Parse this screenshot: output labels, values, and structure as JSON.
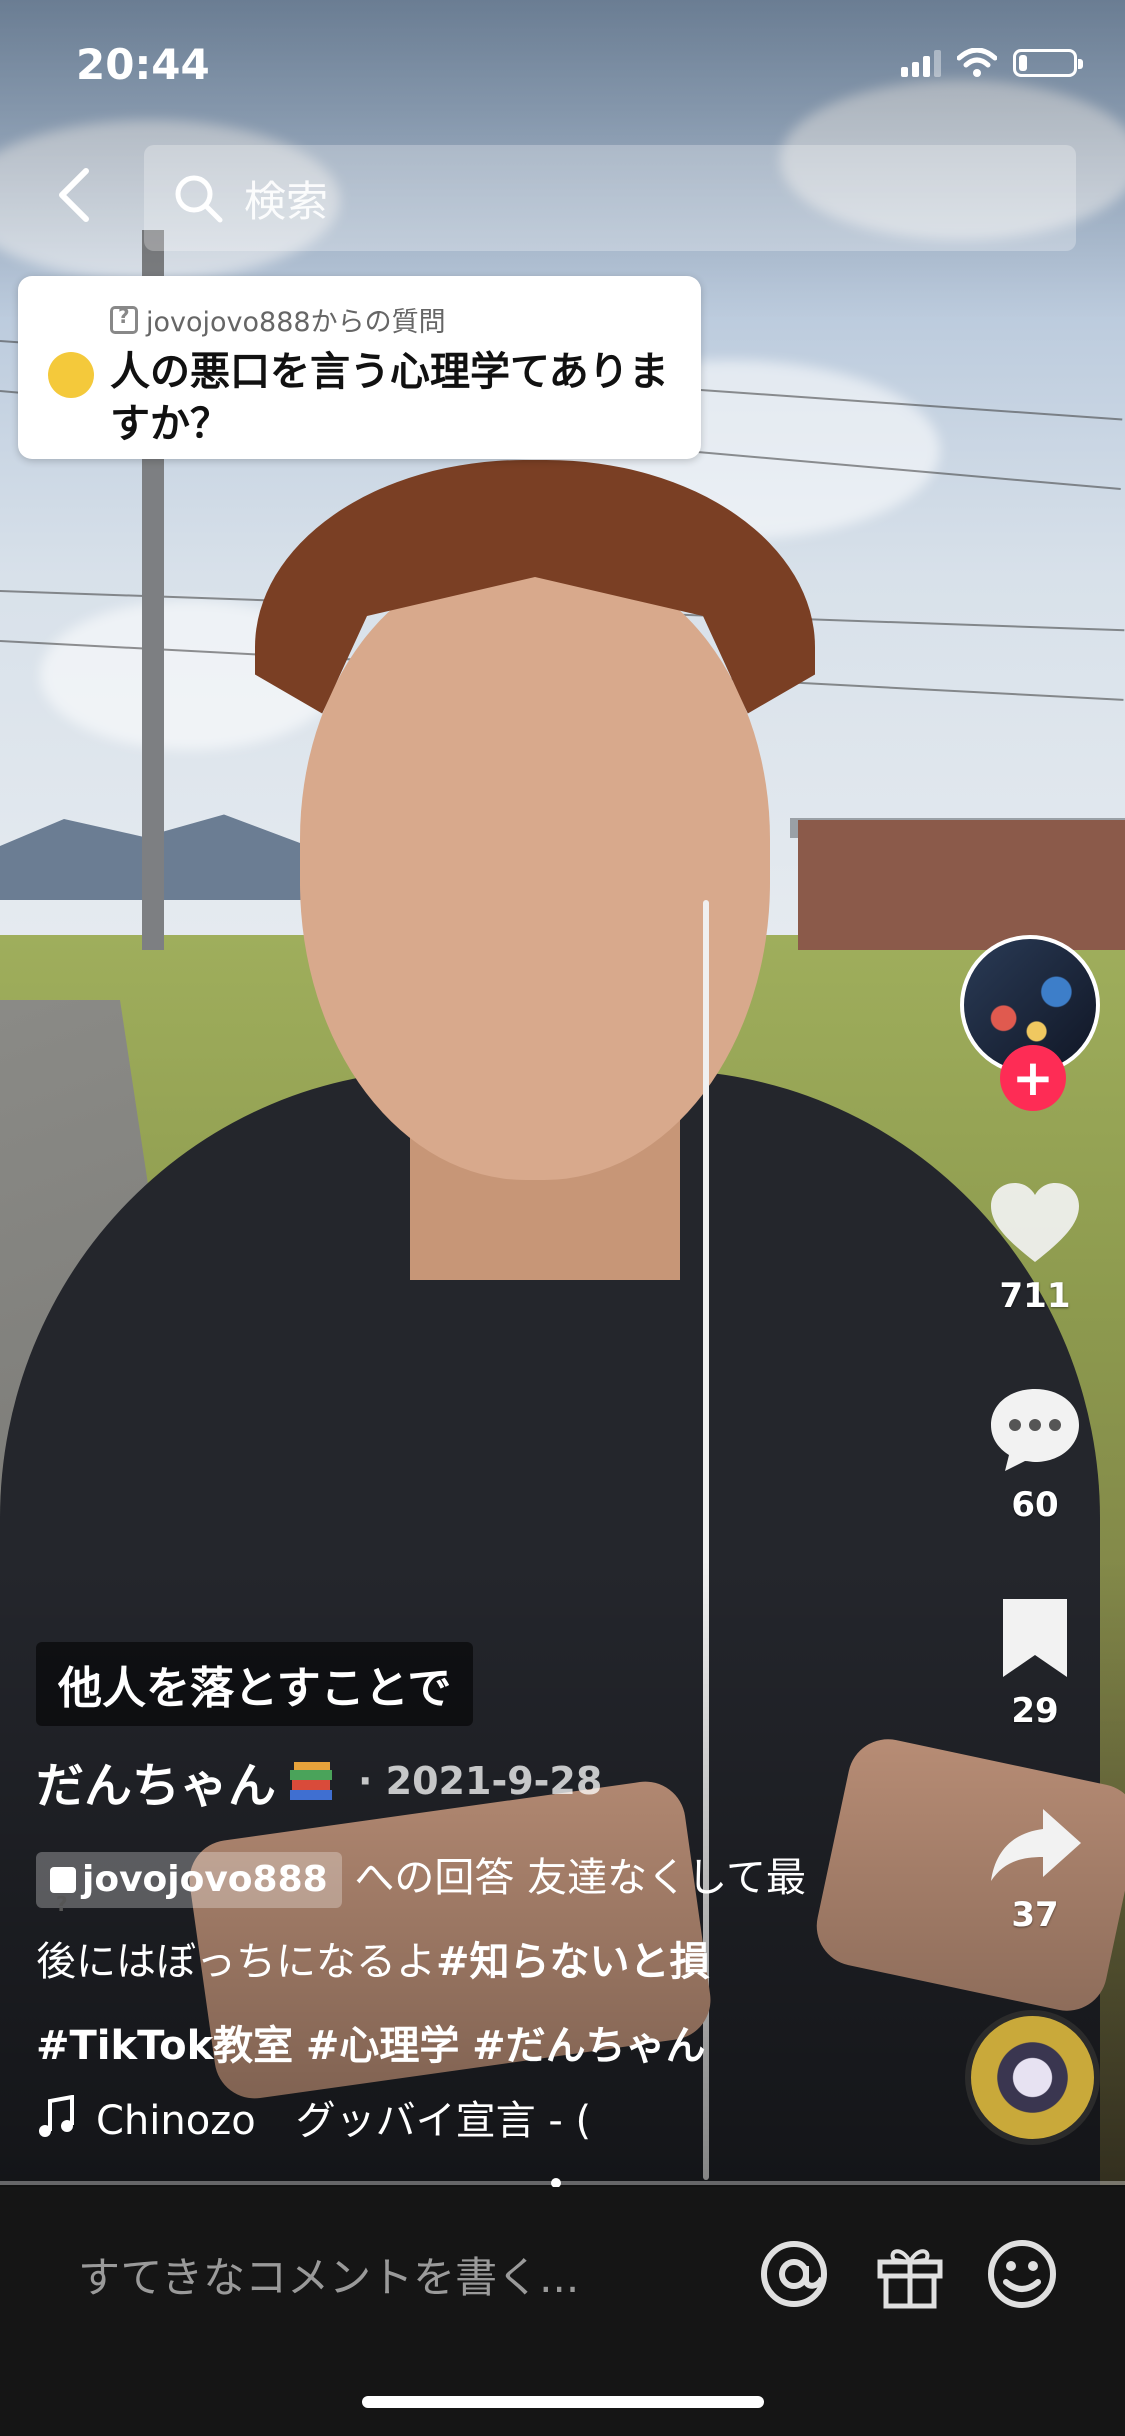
{
  "status_bar": {
    "time": "20:44",
    "battery_level": 0.15
  },
  "search": {
    "placeholder": "検索"
  },
  "question_card": {
    "from_user": "jovojovo888からの質問",
    "question": "人の悪口を言う心理学てありますか？"
  },
  "caption": {
    "overlay_text": "他人を落とすことで",
    "username": "だんちゃん",
    "date": "· 2021-9-28",
    "reply_user": "jovojovo888",
    "reply_suffix": "への回答",
    "text": "友達なくして最後にはぼっちになるよ",
    "hashtags": [
      "#知らないと損",
      "#TikTok教室",
      "#心理学",
      "#だんちゃん"
    ]
  },
  "music": {
    "title": "Chinozo　グッバイ宣言 - ("
  },
  "actions": {
    "likes": "711",
    "comments": "60",
    "saves": "29",
    "shares": "37"
  },
  "follow_label": "+",
  "comment_bar": {
    "placeholder": "すてきなコメントを書く..."
  },
  "playback_progress": 0.49,
  "colors": {
    "accent": "#fe2c55",
    "bottom_bar": "#151515"
  },
  "icons": [
    "back-icon",
    "search-icon",
    "question-icon",
    "heart-icon",
    "comment-icon",
    "bookmark-icon",
    "share-icon",
    "music-note-icon",
    "at-icon",
    "gift-icon",
    "emoji-icon",
    "books-icon"
  ]
}
